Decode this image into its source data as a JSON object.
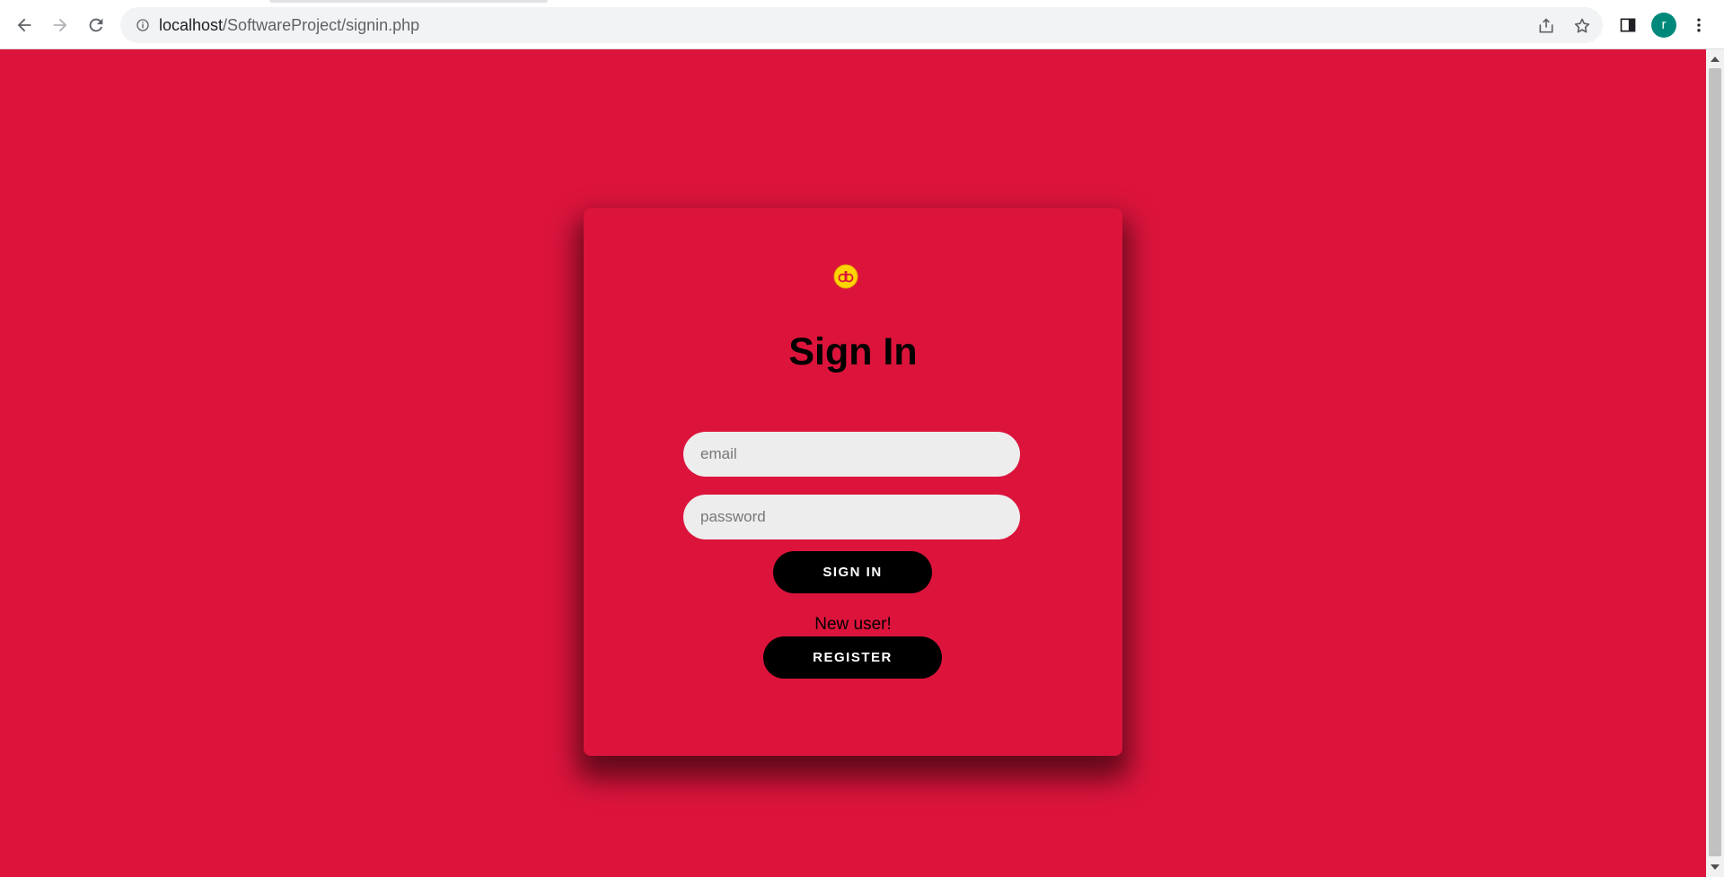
{
  "browser": {
    "url_host": "localhost",
    "url_path": "/SoftwareProject/signin.php",
    "profile_initial": "r"
  },
  "signin": {
    "title": "Sign In",
    "email_placeholder": "email",
    "password_placeholder": "password",
    "signin_label": "SIGN IN",
    "new_user_text": "New user!",
    "register_label": "REGISTER"
  },
  "colors": {
    "background": "#dc143c",
    "button": "#000000",
    "input": "#ededed",
    "logo": "#ffd400"
  },
  "icons": {
    "back": "back-arrow-icon",
    "forward": "forward-arrow-icon",
    "reload": "reload-icon",
    "site_info": "info-icon",
    "share": "share-icon",
    "bookmark": "star-icon",
    "side_panel": "side-panel-icon",
    "menu": "more-vert-icon",
    "logo": "logo-icon"
  }
}
